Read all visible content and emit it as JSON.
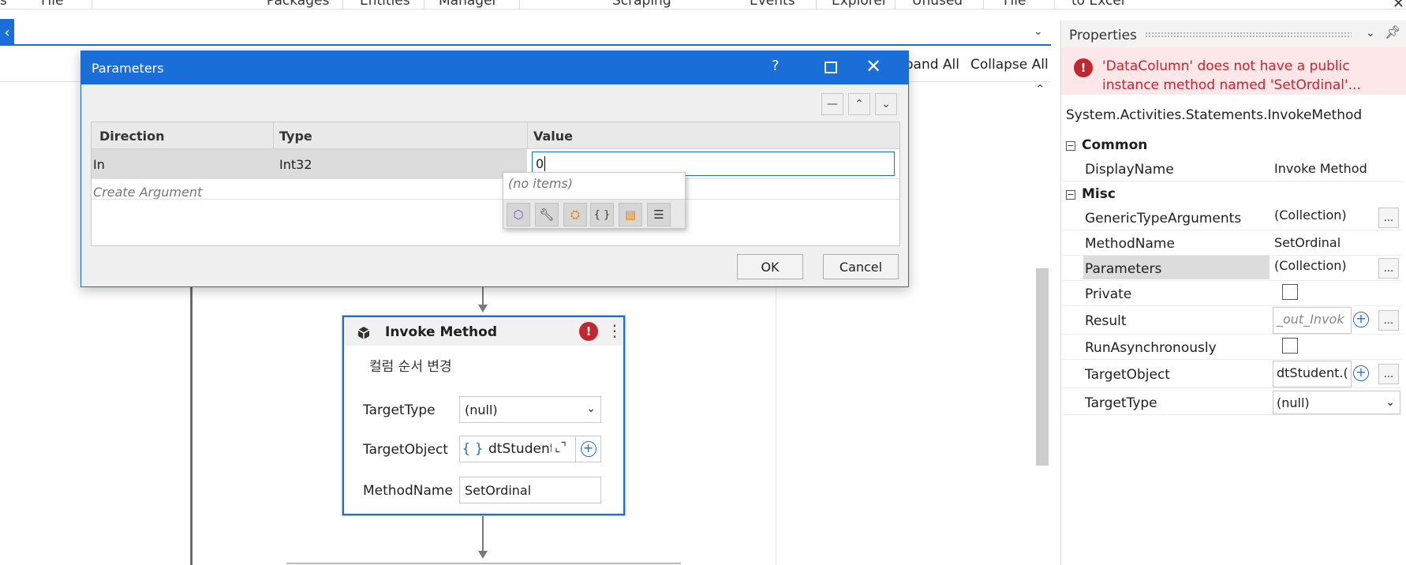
{
  "ribbon": {
    "items": [
      "s",
      "File",
      "Packages",
      "Entities",
      "Manager",
      "Scraping",
      "Events",
      "Explorer",
      "Unused",
      "File",
      "to Excel"
    ],
    "close_glyph": "✕"
  },
  "designer": {
    "toolbar": {
      "expand_all": "Expand All",
      "collapse_all": "Collapse All"
    }
  },
  "activity": {
    "title": "Invoke Method",
    "display_name": "컬럼 순서 변경",
    "fields": {
      "target_type_label": "TargetType",
      "target_type_value": "(null)",
      "target_object_label": "TargetObject",
      "target_object_value": "dtStudent",
      "method_name_label": "MethodName",
      "method_name_value": "SetOrdinal"
    },
    "error_glyph": "!"
  },
  "dialog": {
    "title": "Parameters",
    "help_glyph": "?",
    "columns": [
      "Direction",
      "Type",
      "Value"
    ],
    "rows": [
      {
        "direction": "In",
        "type": "Int32",
        "value": "0"
      }
    ],
    "create_argument": "Create Argument",
    "ok_label": "OK",
    "cancel_label": "Cancel"
  },
  "intellisense": {
    "empty_text": "(no items)"
  },
  "properties": {
    "title": "Properties",
    "error_message": "'DataColumn' does not have a public instance method named 'SetOrdinal'...",
    "type_name": "System.Activities.Statements.InvokeMethod",
    "categories": {
      "common": "Common",
      "misc": "Misc"
    },
    "rows": {
      "display_name": {
        "name": "DisplayName",
        "value": "Invoke Method"
      },
      "generic_type_arguments": {
        "name": "GenericTypeArguments",
        "value": "(Collection)"
      },
      "method_name": {
        "name": "MethodName",
        "value": "SetOrdinal"
      },
      "parameters": {
        "name": "Parameters",
        "value": "(Collection)"
      },
      "private": {
        "name": "Private"
      },
      "result": {
        "name": "Result",
        "placeholder": "_out_Invok"
      },
      "run_async": {
        "name": "RunAsynchronously"
      },
      "target_object": {
        "name": "TargetObject",
        "value": "dtStudent.("
      },
      "target_type": {
        "name": "TargetType",
        "value": "(null)"
      }
    },
    "ellipsis": "..."
  },
  "colors": {
    "accent": "#1a6ed8",
    "error": "#c4262e",
    "error_bg": "#fde7e9"
  }
}
